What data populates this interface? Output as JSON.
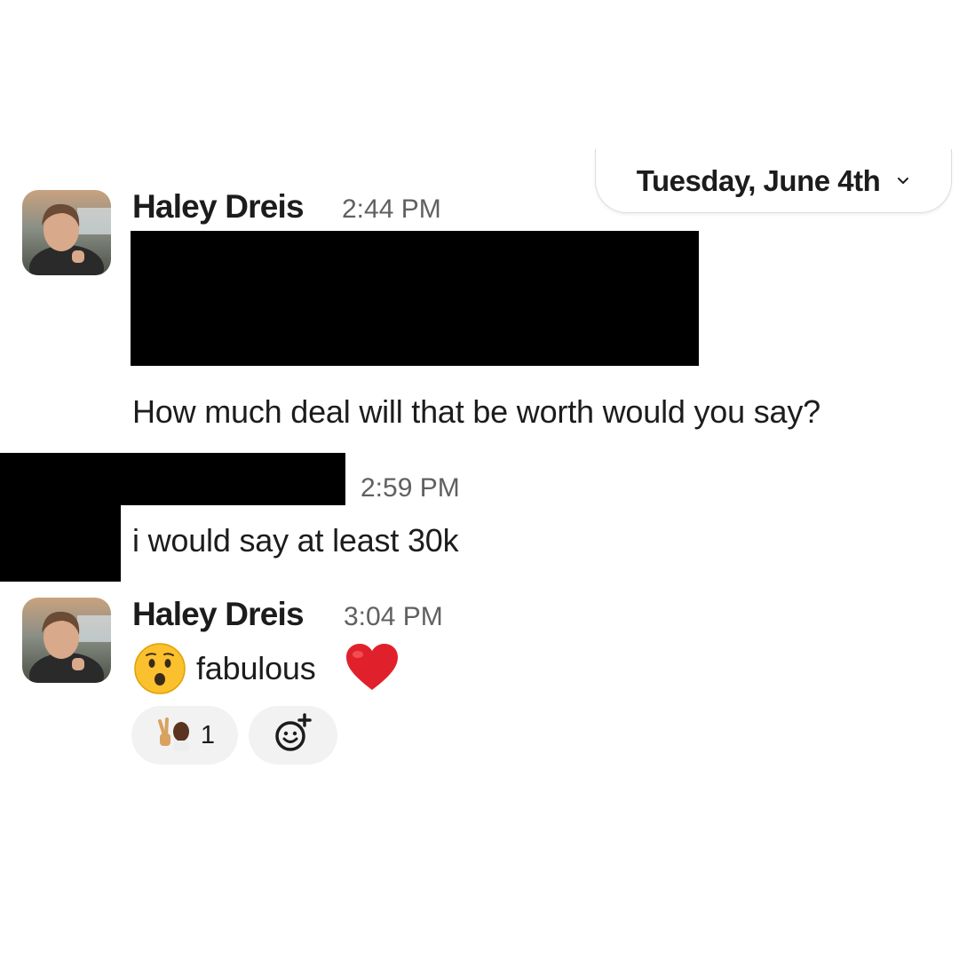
{
  "date_divider": {
    "label": "Tuesday, June 4th",
    "icon": "chevron-down-icon"
  },
  "messages": [
    {
      "sender": "Haley Dreis",
      "time": "2:44 PM",
      "redacted_block": true,
      "text": "How much deal will that be worth would you say?"
    },
    {
      "sender_redacted": true,
      "time": "2:59 PM",
      "text": "i would say at least 30k"
    },
    {
      "sender": "Haley Dreis",
      "time": "3:04 PM",
      "emoji_prefix": "hushed-face-emoji",
      "text": "fabulous",
      "emoji_suffix": "red-heart-emoji",
      "reactions": [
        {
          "emoji": "victory-hand-emoji",
          "count": "1"
        }
      ],
      "add_reaction_icon": "add-reaction-icon"
    }
  ],
  "colors": {
    "text": "#1d1c1d",
    "timestamp": "#616061",
    "redaction": "#000000",
    "reaction_bg": "#f2f2f2",
    "heart": "#e0212b",
    "emoji_face": "#fbc02d"
  }
}
